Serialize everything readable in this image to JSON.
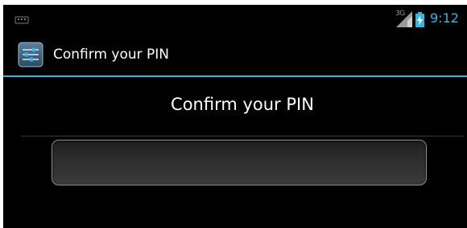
{
  "status_bar": {
    "network_type": "3G",
    "time": "9:12",
    "notification_icon": "usb-debugging-icon",
    "signal_icon": "signal-strength-icon",
    "battery_icon": "battery-charging-icon"
  },
  "action_bar": {
    "app_icon": "settings-sliders-icon",
    "title": "Confirm your PIN"
  },
  "main": {
    "heading": "Confirm your PIN",
    "pin_input": {
      "value": "",
      "placeholder": ""
    }
  },
  "colors": {
    "accent": "#33b5e5",
    "background": "#000000",
    "text": "#ffffff"
  }
}
